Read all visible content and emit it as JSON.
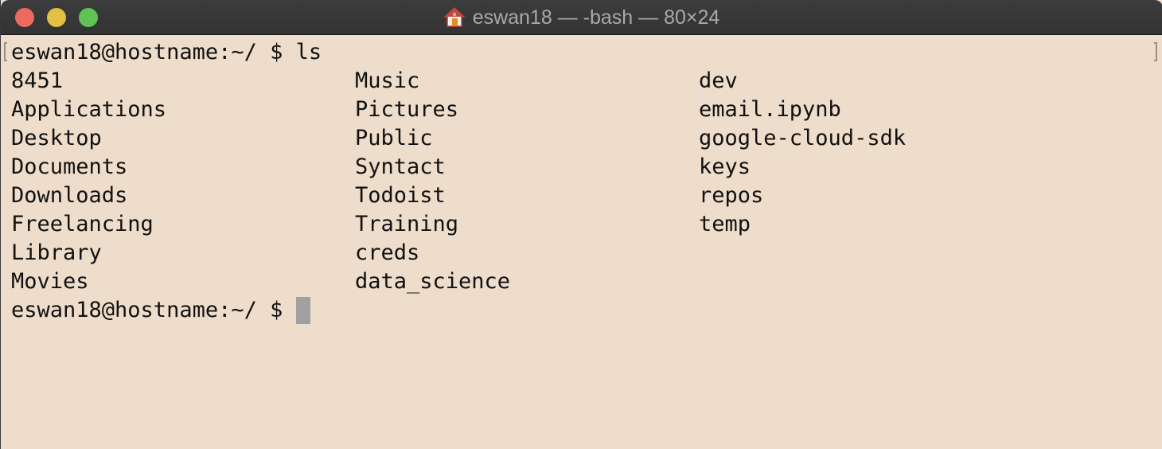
{
  "window": {
    "title": "eswan18 — -bash — 80×24",
    "title_icon": "home-icon",
    "background_color": "#EEDDCB",
    "traffic_lights": [
      "close",
      "minimize",
      "maximize"
    ]
  },
  "terminal": {
    "prompt": "eswan18@hostname:~/ $ ",
    "command": "ls",
    "listing": [
      [
        "8451",
        "Music",
        "dev"
      ],
      [
        "Applications",
        "Pictures",
        "email.ipynb"
      ],
      [
        "Desktop",
        "Public",
        "google-cloud-sdk"
      ],
      [
        "Documents",
        "Syntact",
        "keys"
      ],
      [
        "Downloads",
        "Todoist",
        "repos"
      ],
      [
        "Freelancing",
        "Training",
        "temp"
      ],
      [
        "Library",
        "creds",
        ""
      ],
      [
        "Movies",
        "data_science",
        ""
      ]
    ],
    "final_prompt": "eswan18@hostname:~/ $ "
  }
}
